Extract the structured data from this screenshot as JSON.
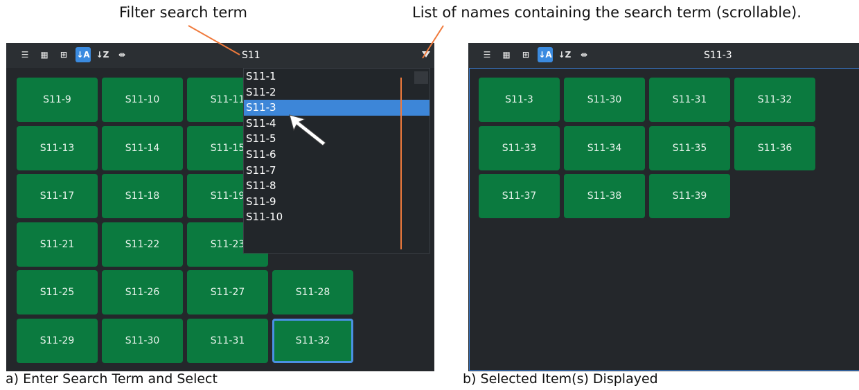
{
  "annotations": {
    "filter_search_term": "Filter search term",
    "names_list": "List of names containing the search term (scrollable)."
  },
  "captions": {
    "left": "a) Enter Search Term and Select",
    "right": "b) Selected Item(s) Displayed"
  },
  "toolbar_icons": [
    "list-view-icon",
    "large-tile-icon",
    "small-tile-icon",
    "sort-ascending-icon",
    "sort-descending-icon",
    "fit-width-icon"
  ],
  "left_panel": {
    "search_value": "S11",
    "tiles": [
      "S11-9",
      "S11-10",
      "S11-11",
      "",
      "S11-13",
      "S11-14",
      "S11-15",
      "",
      "S11-17",
      "S11-18",
      "S11-19",
      "",
      "S11-21",
      "S11-22",
      "S11-23",
      "",
      "S11-25",
      "S11-26",
      "S11-27",
      "S11-28",
      "S11-29",
      "S11-30",
      "S11-31",
      "S11-32"
    ],
    "selected_tile": "S11-32",
    "dropdown": {
      "items": [
        "S11-1",
        "S11-2",
        "S11-3",
        "S11-4",
        "S11-5",
        "S11-6",
        "S11-7",
        "S11-8",
        "S11-9",
        "S11-10"
      ],
      "highlighted": "S11-3"
    }
  },
  "right_panel": {
    "search_value": "S11-3",
    "tiles": [
      "S11-3",
      "S11-30",
      "S11-31",
      "S11-32",
      "S11-33",
      "S11-34",
      "S11-35",
      "S11-36",
      "S11-37",
      "S11-38",
      "S11-39"
    ]
  },
  "colors": {
    "panel_bg": "#24272b",
    "tile_green": "#0b7a3f",
    "accent_blue": "#3b8be0",
    "annotation_line": "#f07a3c"
  }
}
